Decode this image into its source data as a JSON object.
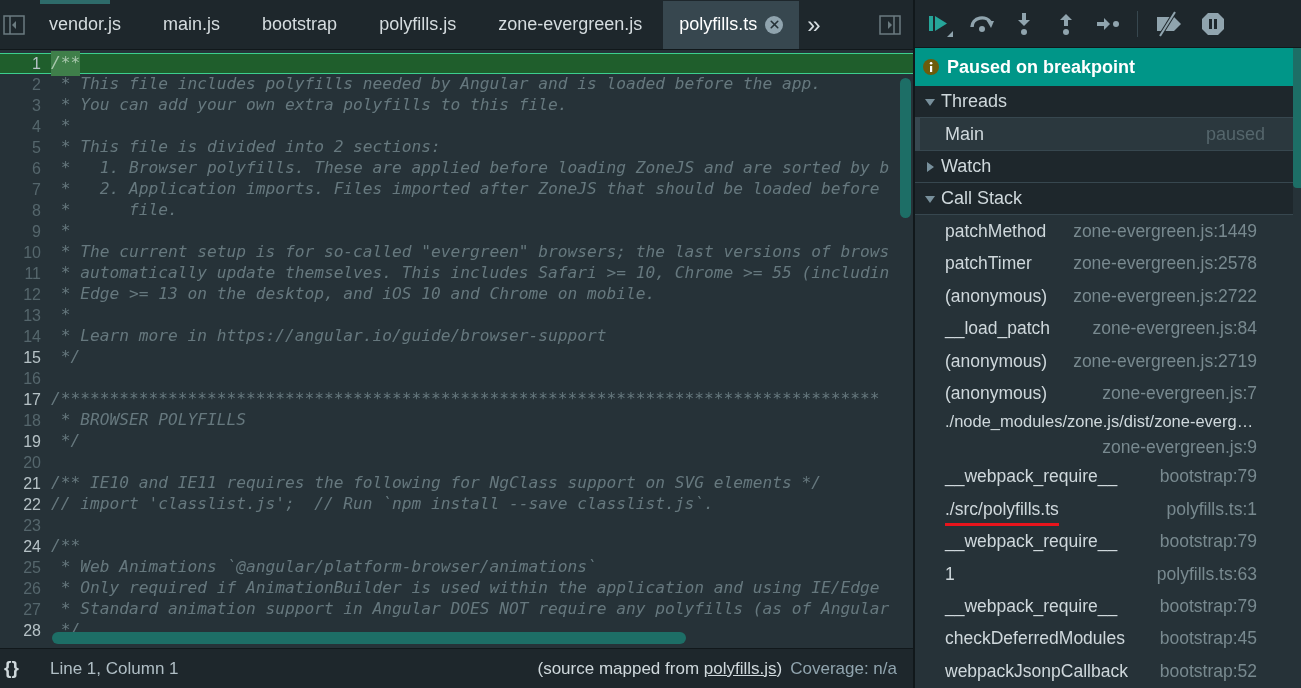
{
  "editor": {
    "tabs": [
      {
        "label": "vendor.js",
        "selected": false
      },
      {
        "label": "main.js",
        "selected": false
      },
      {
        "label": "bootstrap",
        "selected": false
      },
      {
        "label": "polyfills.js",
        "selected": false
      },
      {
        "label": "zone-evergreen.js",
        "selected": false
      },
      {
        "label": "polyfills.ts",
        "selected": true
      }
    ],
    "overflow": "»",
    "lines": [
      {
        "number": "1",
        "text": "/**",
        "selected": true,
        "emphasized": true
      },
      {
        "number": "2",
        "text": " * This file includes polyfills needed by Angular and is loaded before the app.",
        "selected": false,
        "emphasized": false
      },
      {
        "number": "3",
        "text": " * You can add your own extra polyfills to this file.",
        "selected": false,
        "emphasized": false
      },
      {
        "number": "4",
        "text": " *",
        "selected": false,
        "emphasized": false
      },
      {
        "number": "5",
        "text": " * This file is divided into 2 sections:",
        "selected": false,
        "emphasized": false
      },
      {
        "number": "6",
        "text": " *   1. Browser polyfills. These are applied before loading ZoneJS and are sorted by b",
        "selected": false,
        "emphasized": false
      },
      {
        "number": "7",
        "text": " *   2. Application imports. Files imported after ZoneJS that should be loaded before",
        "selected": false,
        "emphasized": false
      },
      {
        "number": "8",
        "text": " *      file.",
        "selected": false,
        "emphasized": false
      },
      {
        "number": "9",
        "text": " *",
        "selected": false,
        "emphasized": false
      },
      {
        "number": "10",
        "text": " * The current setup is for so-called \"evergreen\" browsers; the last versions of brows",
        "selected": false,
        "emphasized": false
      },
      {
        "number": "11",
        "text": " * automatically update themselves. This includes Safari >= 10, Chrome >= 55 (includin",
        "selected": false,
        "emphasized": false
      },
      {
        "number": "12",
        "text": " * Edge >= 13 on the desktop, and iOS 10 and Chrome on mobile.",
        "selected": false,
        "emphasized": false
      },
      {
        "number": "13",
        "text": " *",
        "selected": false,
        "emphasized": false
      },
      {
        "number": "14",
        "text": " * Learn more in https://angular.io/guide/browser-support",
        "selected": false,
        "emphasized": false
      },
      {
        "number": "15",
        "text": " */",
        "selected": false,
        "emphasized": true
      },
      {
        "number": "16",
        "selected": false,
        "emphasized": false
      },
      {
        "number": "17",
        "text": "/************************************************************************************",
        "selected": false,
        "emphasized": true
      },
      {
        "number": "18",
        "text": " * BROWSER POLYFILLS",
        "selected": false,
        "emphasized": false
      },
      {
        "number": "19",
        "text": " */",
        "selected": false,
        "emphasized": true
      },
      {
        "number": "20",
        "selected": false,
        "emphasized": false
      },
      {
        "number": "21",
        "text": "/** IE10 and IE11 requires the following for NgClass support on SVG elements */",
        "selected": false,
        "emphasized": true
      },
      {
        "number": "22",
        "text": "// import 'classlist.js';  // Run `npm install --save classlist.js`.",
        "selected": false,
        "emphasized": true
      },
      {
        "number": "23",
        "selected": false,
        "emphasized": false
      },
      {
        "number": "24",
        "text": "/**",
        "selected": false,
        "emphasized": true
      },
      {
        "number": "25",
        "text": " * Web Animations `@angular/platform-browser/animations`",
        "selected": false,
        "emphasized": false
      },
      {
        "number": "26",
        "text": " * Only required if AnimationBuilder is used within the application and using IE/Edge",
        "selected": false,
        "emphasized": false
      },
      {
        "number": "27",
        "text": " * Standard animation support in Angular DOES NOT require any polyfills (as of Angular",
        "selected": false,
        "emphasized": false
      },
      {
        "number": "28",
        "text": " */",
        "selected": false,
        "emphasized": true
      }
    ],
    "status": {
      "format": "{}",
      "position": "Line 1, Column 1",
      "source_prefix": "(source mapped from ",
      "source_link": "polyfills.js",
      "source_suffix": ")",
      "coverage": "Coverage: n/a"
    }
  },
  "debugger": {
    "banner": "Paused on breakpoint",
    "sections": [
      {
        "kind": "threads",
        "title": "Threads",
        "expanded": true,
        "threads": [
          {
            "name": "Main",
            "state": "paused",
            "selected": true
          }
        ]
      },
      {
        "kind": "watch",
        "title": "Watch",
        "expanded": false
      },
      {
        "kind": "call_stack",
        "title": "Call Stack",
        "expanded": true,
        "frames": [
          {
            "name": "patchMethod",
            "location": "zone-evergreen.js:1449",
            "underlined": false
          },
          {
            "name": "patchTimer",
            "location": "zone-evergreen.js:2578",
            "underlined": false
          },
          {
            "name": "(anonymous)",
            "location": "zone-evergreen.js:2722",
            "underlined": false
          },
          {
            "name": "__load_patch",
            "location": "zone-evergreen.js:84",
            "underlined": false
          },
          {
            "name": "(anonymous)",
            "location": "zone-evergreen.js:2719",
            "underlined": false
          },
          {
            "name": "(anonymous)",
            "location": "zone-evergreen.js:7",
            "underlined": false
          },
          {
            "name": "./node_modules/zone.js/dist/zone-everg…",
            "location": "zone-evergreen.js:9",
            "underlined": false
          },
          {
            "name": "__webpack_require__",
            "location": "bootstrap:79",
            "underlined": false
          },
          {
            "name": "./src/polyfills.ts",
            "location": "polyfills.ts:1",
            "underlined": true
          },
          {
            "name": "__webpack_require__",
            "location": "bootstrap:79",
            "underlined": false
          },
          {
            "name": "1",
            "location": "polyfills.ts:63",
            "underlined": false
          },
          {
            "name": "__webpack_require__",
            "location": "bootstrap:79",
            "underlined": false
          },
          {
            "name": "checkDeferredModules",
            "location": "bootstrap:45",
            "underlined": false
          },
          {
            "name": "webpackJsonpCallback",
            "location": "bootstrap:52",
            "underlined": false
          }
        ]
      }
    ]
  }
}
